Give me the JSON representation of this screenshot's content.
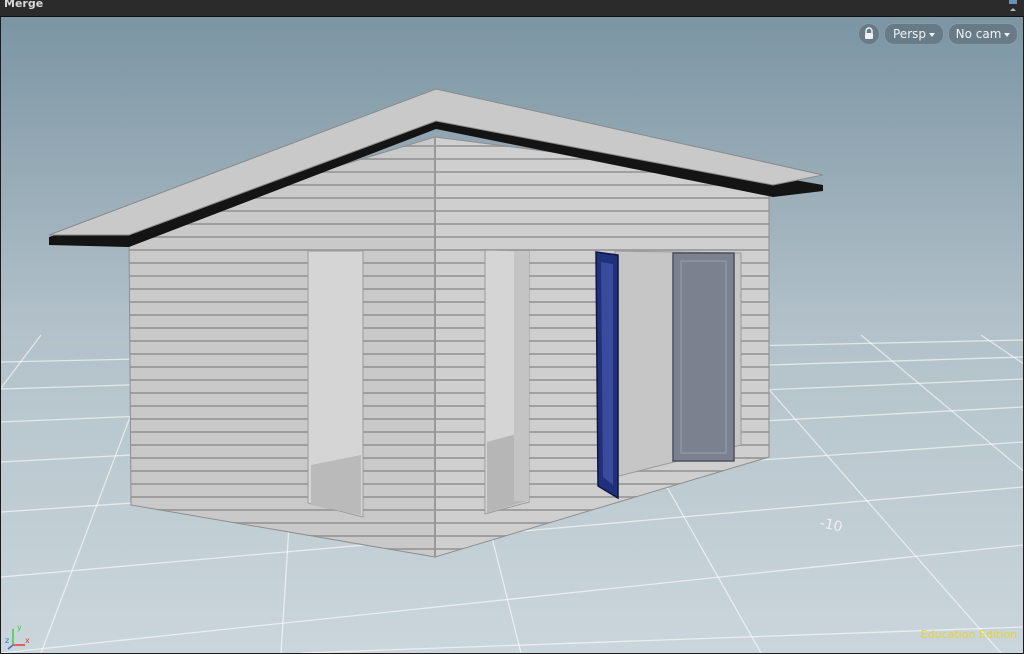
{
  "pane": {
    "title": "Merge"
  },
  "viewport": {
    "view_menu": "Persp",
    "camera_menu": "No cam",
    "watermark": "Education Edition",
    "grid_label": "-10",
    "axis": {
      "x": "x",
      "y": "y",
      "z": "z"
    }
  },
  "colors": {
    "sky_top": "#7f98a6",
    "sky_bottom": "#b3c2ca",
    "floor": "#c3d0d6",
    "grid_line": "#ffffff",
    "wall_light": "#cdcdcd",
    "wall_dark": "#bdbdbd",
    "roof_top": "#c8c8c8",
    "roof_edge": "#141414",
    "door_selected": "#1f2f7a",
    "door_panel": "#7b808e",
    "watermark": "#e6d23a"
  },
  "icons": [
    "lock-icon",
    "dropdown-caret-icon",
    "axis-gizmo-icon"
  ]
}
